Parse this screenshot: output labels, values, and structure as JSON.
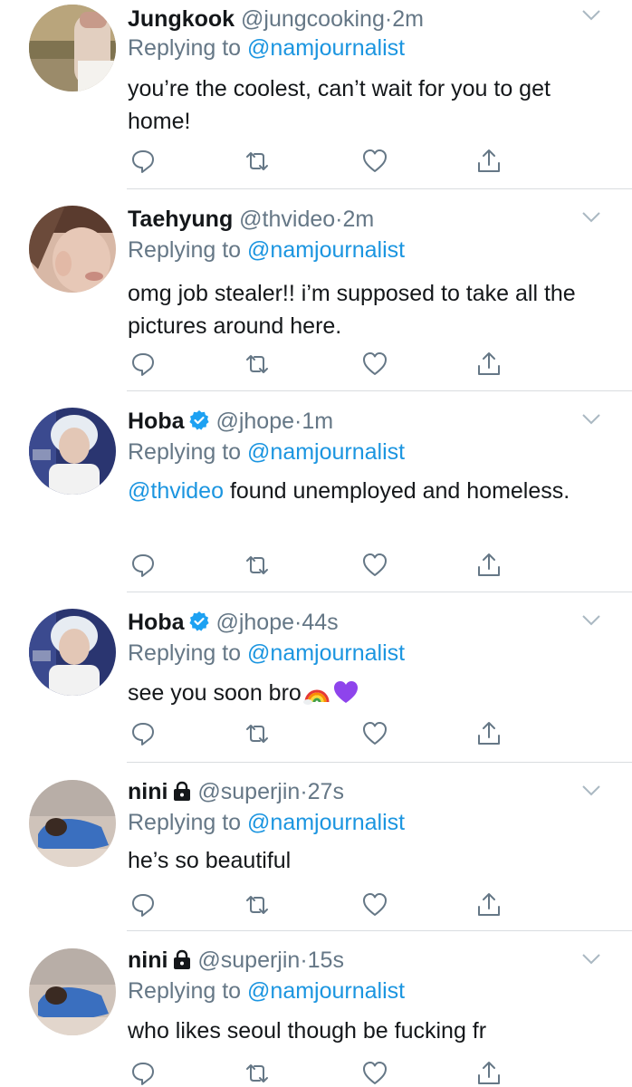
{
  "reply_prefix": "Replying to",
  "tweets": [
    {
      "name": "Jungkook",
      "handle": "@jungcooking",
      "separator": "·",
      "time": "2m",
      "replying_to": "@namjournalist",
      "verified": false,
      "locked": false,
      "text": "you’re the coolest, can’t wait for you to get home!",
      "avatar": "avatar-jungkook"
    },
    {
      "name": "Taehyung",
      "handle": "@thvideo",
      "separator": "·",
      "time": "2m",
      "replying_to": "@namjournalist",
      "verified": false,
      "locked": false,
      "text": "omg job stealer!! i’m supposed to take all the pictures around here.",
      "avatar": "avatar-taehyung"
    },
    {
      "name": "Hoba",
      "handle": "@jhope",
      "separator": "·",
      "time": "1m",
      "replying_to": "@namjournalist",
      "verified": true,
      "locked": false,
      "text_mention": "@thvideo",
      "text": " found unemployed and homeless.",
      "avatar": "avatar-hoba"
    },
    {
      "name": "Hoba",
      "handle": "@jhope",
      "separator": "·",
      "time": "44s",
      "replying_to": "@namjournalist",
      "verified": true,
      "locked": false,
      "text": "see you soon bro",
      "emojis": [
        "rainbow-emoji",
        "purple-heart-emoji"
      ],
      "avatar": "avatar-hoba"
    },
    {
      "name": "nini",
      "handle": "@superjin",
      "separator": "·",
      "time": "27s",
      "replying_to": "@namjournalist",
      "verified": false,
      "locked": true,
      "text": "he’s so beautiful",
      "avatar": "avatar-nini"
    },
    {
      "name": "nini",
      "handle": "@superjin",
      "separator": "·",
      "time": "15s",
      "replying_to": "@namjournalist",
      "verified": false,
      "locked": true,
      "text": "who likes seoul though be fucking fr",
      "avatar": "avatar-nini"
    }
  ],
  "icons": {
    "reply": "reply-icon",
    "retweet": "retweet-icon",
    "like": "like-icon",
    "share": "share-icon",
    "more": "chevron-down-icon",
    "verified": "verified-badge-icon",
    "locked": "lock-icon"
  },
  "colors": {
    "text": "#14171a",
    "secondary": "#657786",
    "link": "#1b95e0",
    "verified": "#1da1f2",
    "divider": "#d9dde0"
  }
}
